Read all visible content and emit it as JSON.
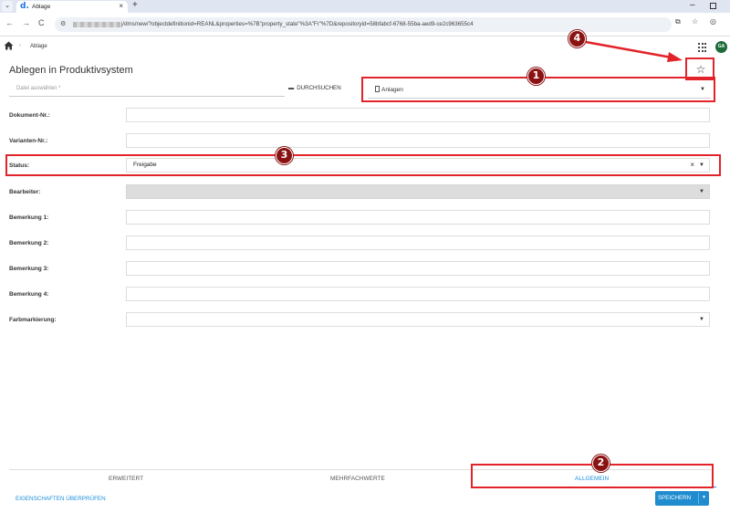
{
  "browser": {
    "tab_title": "Ablage",
    "tab_favicon": "d.",
    "url_text": "j/dms/new/?objectdefinitionid=REANL&properties=%7B\"property_state\"%3A\"Fr\"%7D&repositoryid=58bfabcf-6768-55ba-aed9-ce2c963655c4"
  },
  "app": {
    "breadcrumb": "Ablage",
    "page_title": "Ablegen in Produktivsystem",
    "avatar_initials": "GA"
  },
  "file": {
    "placeholder": "Datei auswählen *",
    "browse_label": "DURCHSUCHEN",
    "kind_value": "Anlagen"
  },
  "form": {
    "document_no_label": "Dokument-Nr.:",
    "variant_no_label": "Varianten-Nr.:",
    "status_label": "Status:",
    "status_value": "Freigabe",
    "editor_label": "Bearbeiter:",
    "remark1_label": "Bemerkung 1:",
    "remark2_label": "Bemerkung 2:",
    "remark3_label": "Bemerkung 3:",
    "remark4_label": "Bemerkung 4:",
    "color_label": "Farbmarkierung:"
  },
  "bottom_tabs": {
    "extended": "ERWEITERT",
    "multi": "MEHRFACHWERTE",
    "general": "ALLGEMEIN"
  },
  "footer": {
    "check_link": "EIGENSCHAFTEN ÜBERPRÜFEN",
    "save_label": "SPEICHERN"
  },
  "annotations": {
    "badge1": "1",
    "badge2": "2",
    "badge3": "3",
    "badge4": "4",
    "color": "#e2232a"
  }
}
